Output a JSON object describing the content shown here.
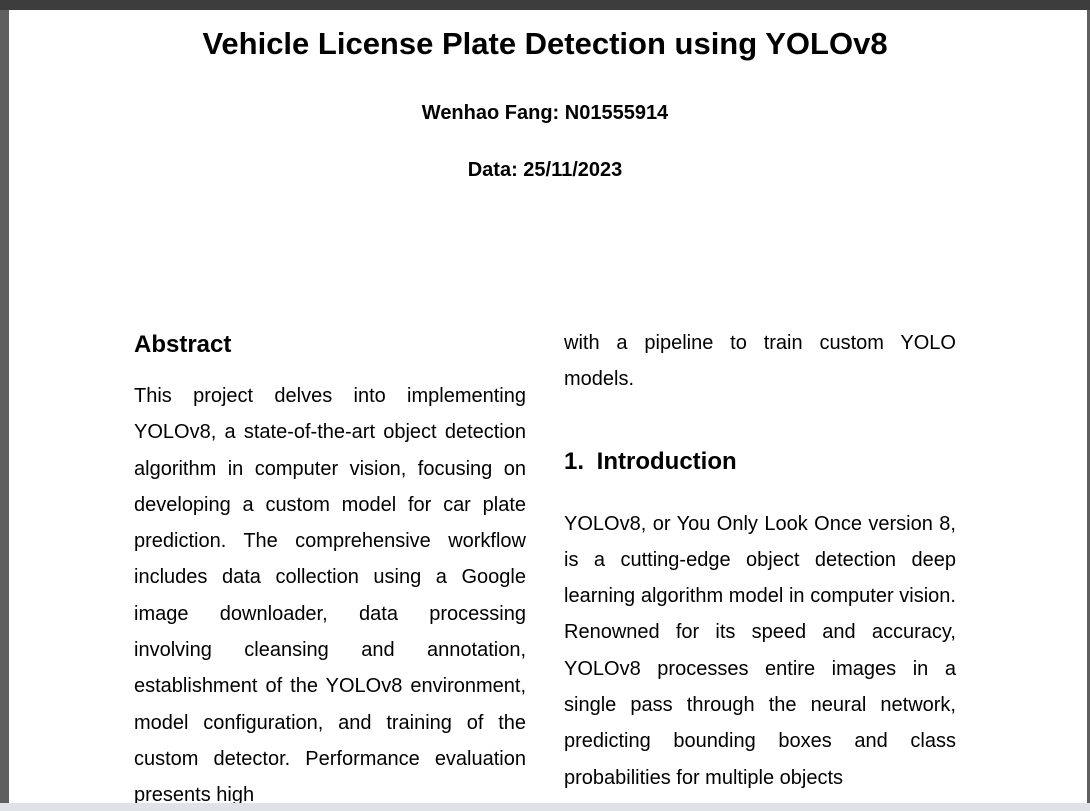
{
  "document": {
    "title": "Vehicle License Plate Detection using YOLOv8",
    "author": "Wenhao Fang: N01555914",
    "date": "Data: 25/11/2023"
  },
  "abstract": {
    "heading": "Abstract",
    "text": "This project delves into implementing YOLOv8, a state-of-the-art object detection algorithm in computer vision, focusing on developing a custom model for car plate prediction. The comprehensive workflow includes data collection using a Google image downloader, data processing involving cleansing and annotation, establishment of the YOLOv8 environment, model configuration, and training of the custom detector. Performance evaluation presents high",
    "continuation": "with a pipeline to train custom YOLO models."
  },
  "introduction": {
    "heading": "1.  Introduction",
    "text": "YOLOv8, or You Only Look Once version 8, is a cutting-edge object detection deep learning algorithm model in computer vision. Renowned for its speed and accuracy, YOLOv8 processes entire images in a single pass through the neural network, predicting bounding boxes and class probabilities for multiple objects"
  }
}
